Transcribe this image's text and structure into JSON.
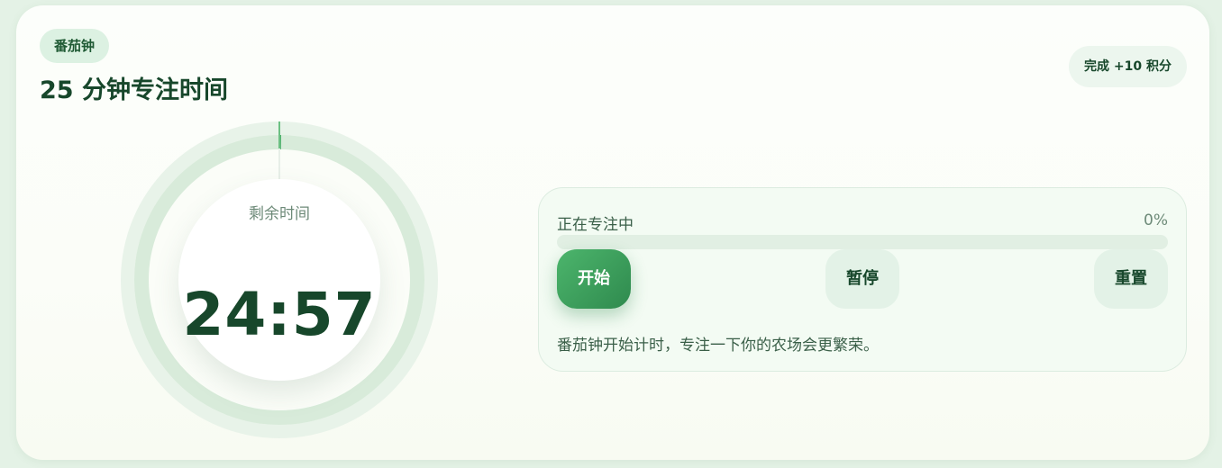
{
  "header": {
    "badge": "番茄钟",
    "title": "25 分钟专注时间",
    "reward": "完成 +10 积分"
  },
  "timer": {
    "remaining_label": "剩余时间",
    "time": "24:57",
    "ring_progress": 0.002
  },
  "panel": {
    "status": "正在专注中",
    "percent_text": "0%",
    "progress": 0,
    "buttons": {
      "start": "开始",
      "pause": "暂停",
      "reset": "重置"
    },
    "hint": "番茄钟开始计时，专注一下你的农场会更繁荣。"
  },
  "colors": {
    "accent": "#2f8a4e",
    "accent_light": "#4cb56c",
    "title": "#17472b",
    "ring_outer": "#e8f3e9",
    "ring_track": "#d8ebda"
  }
}
